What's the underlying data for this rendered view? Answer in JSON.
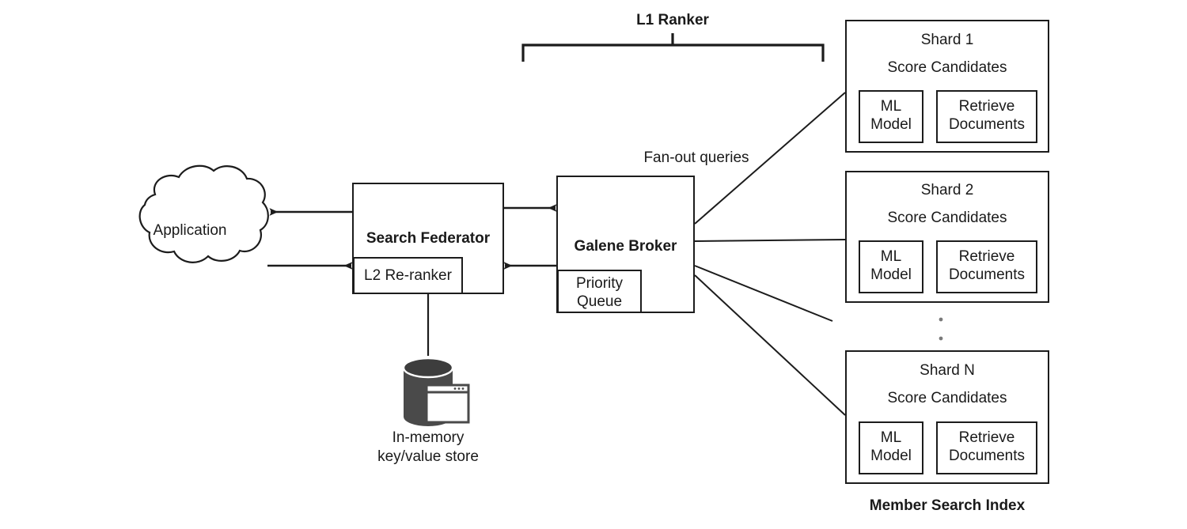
{
  "diagram": {
    "title_bracket": "L1 Ranker",
    "fanout_label": "Fan-out queries",
    "index_label": "Member Search Index",
    "application": "Application",
    "federator": {
      "title": "Search Federator",
      "inner": "L2 Re-ranker"
    },
    "broker": {
      "title": "Galene Broker",
      "inner_line1": "Priority",
      "inner_line2": "Queue"
    },
    "store": {
      "line1": "In-memory",
      "line2": "key/value store",
      "icon": "database-cylinder-icon",
      "icon_secondary": "window-icon"
    },
    "shards": [
      {
        "name": "Shard 1",
        "subtitle": "Score Candidates",
        "ml_line1": "ML",
        "ml_line2": "Model",
        "retrieve_line1": "Retrieve",
        "retrieve_line2": "Documents"
      },
      {
        "name": "Shard 2",
        "subtitle": "Score Candidates",
        "ml_line1": "ML",
        "ml_line2": "Model",
        "retrieve_line1": "Retrieve",
        "retrieve_line2": "Documents"
      },
      {
        "name": "Shard N",
        "subtitle": "Score Candidates",
        "ml_line1": "ML",
        "ml_line2": "Model",
        "retrieve_line1": "Retrieve",
        "retrieve_line2": "Documents"
      }
    ],
    "ellipsis_dots": 2,
    "colors": {
      "stroke": "#1c1c1c",
      "text": "#1a1a1a",
      "background": "#ffffff",
      "cylinder_fill": "#4a4a4a",
      "cylinder_top": "#3d3d3d"
    }
  }
}
